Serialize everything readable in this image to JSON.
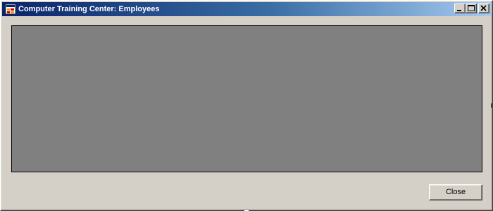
{
  "window": {
    "title": "Computer Training Center: Employees",
    "icon": "application-icon",
    "title_gradient_start": "#0a246a",
    "title_gradient_end": "#a6caf0",
    "caption_buttons": [
      "minimize-icon",
      "maximize-icon",
      "close-icon"
    ]
  },
  "client": {
    "mdi_background": "#808080"
  },
  "footer": {
    "close_label": "Close"
  }
}
